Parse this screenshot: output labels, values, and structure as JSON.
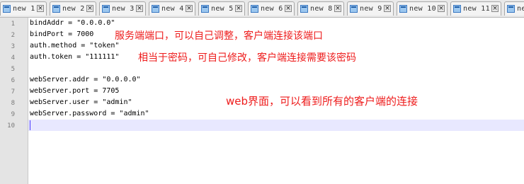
{
  "tabs": [
    {
      "label": "new 1",
      "close_icon": "close-icon"
    },
    {
      "label": "new 2",
      "close_icon": "close-icon"
    },
    {
      "label": "new 3",
      "close_icon": "close-icon"
    },
    {
      "label": "new 4",
      "close_icon": "close-icon"
    },
    {
      "label": "new 5",
      "close_icon": "close-icon"
    },
    {
      "label": "new 6",
      "close_icon": "close-icon"
    },
    {
      "label": "new 8",
      "close_icon": "close-icon"
    },
    {
      "label": "new 9",
      "close_icon": "close-icon"
    },
    {
      "label": "new 10",
      "close_icon": "close-icon"
    },
    {
      "label": "new 11",
      "close_icon": "close-icon"
    },
    {
      "label": "ne",
      "close_icon": "close-icon"
    }
  ],
  "editor": {
    "line_numbers": [
      "1",
      "2",
      "3",
      "4",
      "5",
      "6",
      "7",
      "8",
      "9",
      "10"
    ],
    "lines": [
      "bindAddr = \"0.0.0.0\"",
      "bindPort = 7000",
      "auth.method = \"token\"",
      "auth.token = \"111111\"",
      "",
      "webServer.addr = \"0.0.0.0\"",
      "webServer.port = 7705",
      "webServer.user = \"admin\"",
      "webServer.password = \"admin\"",
      ""
    ],
    "current_line": 10,
    "current_line_color": "#e8e8ff"
  },
  "annotations": {
    "note1": "服务端端口，可以自己调整，客户端连接该端口",
    "note2": "相当于密码，可自己修改，客户端连接需要该密码",
    "note3": "web界面，可以看到所有的客户端的连接",
    "color": "#ee1c1c"
  }
}
